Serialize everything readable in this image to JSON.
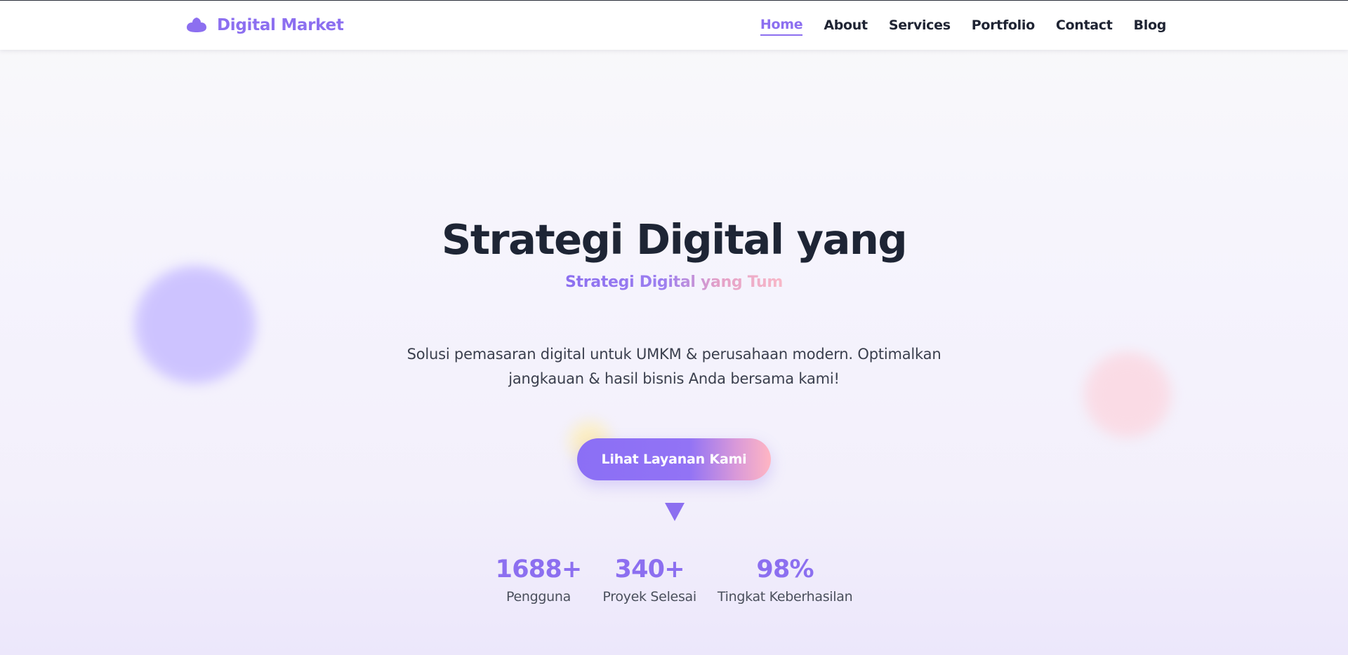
{
  "brand": {
    "name": "Digital Market",
    "icon": "cloud-blob-icon"
  },
  "nav": {
    "items": [
      {
        "label": "Home",
        "active": true
      },
      {
        "label": "About",
        "active": false
      },
      {
        "label": "Services",
        "active": false
      },
      {
        "label": "Portfolio",
        "active": false
      },
      {
        "label": "Contact",
        "active": false
      },
      {
        "label": "Blog",
        "active": false
      }
    ]
  },
  "hero": {
    "title": "Strategi Digital yang",
    "subtitle": "Strategi Digital yang Tum",
    "description": "Solusi pemasaran digital untuk UMKM & perusahaan modern. Optimalkan jangkauan & hasil bisnis Anda bersama kami!",
    "cta_label": "Lihat Layanan Kami",
    "scroll_icon": "triangle-down-icon"
  },
  "stats": [
    {
      "value": "1688+",
      "label": "Pengguna"
    },
    {
      "value": "340+",
      "label": "Proyek Selesai"
    },
    {
      "value": "98%",
      "label": "Tingkat Keberhasilan"
    }
  ],
  "colors": {
    "accent": "#8c6ff0",
    "accent_pink": "#ffb6c3",
    "heading": "#1e2535",
    "body_text": "#3a3f4d"
  }
}
